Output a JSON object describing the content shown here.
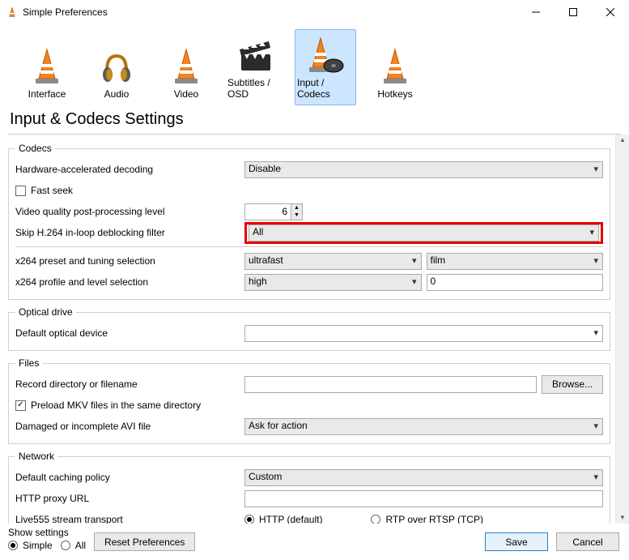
{
  "window": {
    "title": "Simple Preferences"
  },
  "tabs": {
    "interface": "Interface",
    "audio": "Audio",
    "video": "Video",
    "subtitles": "Subtitles / OSD",
    "input": "Input / Codecs",
    "hotkeys": "Hotkeys"
  },
  "heading": "Input & Codecs Settings",
  "codecs": {
    "legend": "Codecs",
    "hw_decode_label": "Hardware-accelerated decoding",
    "hw_decode_value": "Disable",
    "fast_seek_label": "Fast seek",
    "fast_seek_checked": false,
    "vq_label": "Video quality post-processing level",
    "vq_value": "6",
    "skip_label": "Skip H.264 in-loop deblocking filter",
    "skip_value": "All",
    "x264_preset_label": "x264 preset and tuning selection",
    "x264_preset_value": "ultrafast",
    "x264_tuning_value": "film",
    "x264_profile_label": "x264 profile and level selection",
    "x264_profile_value": "high",
    "x264_level_value": "0"
  },
  "optical": {
    "legend": "Optical drive",
    "default_label": "Default optical device",
    "default_value": ""
  },
  "files": {
    "legend": "Files",
    "record_label": "Record directory or filename",
    "record_value": "",
    "browse": "Browse...",
    "preload_label": "Preload MKV files in the same directory",
    "preload_checked": true,
    "damaged_label": "Damaged or incomplete AVI file",
    "damaged_value": "Ask for action"
  },
  "network": {
    "legend": "Network",
    "caching_label": "Default caching policy",
    "caching_value": "Custom",
    "proxy_label": "HTTP proxy URL",
    "proxy_value": "",
    "live_label": "Live555 stream transport",
    "live_http": "HTTP (default)",
    "live_rtp": "RTP over RTSP (TCP)"
  },
  "bottom": {
    "show_settings": "Show settings",
    "simple": "Simple",
    "all": "All",
    "reset": "Reset Preferences",
    "save": "Save",
    "cancel": "Cancel"
  }
}
